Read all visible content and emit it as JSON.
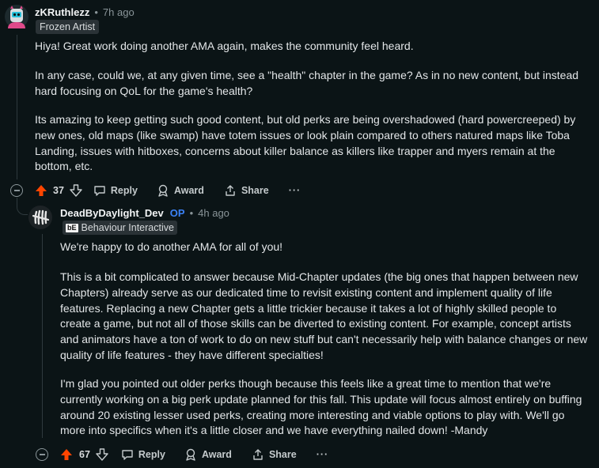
{
  "comment1": {
    "username": "zKRuthlezz",
    "time": "7h ago",
    "flair": "Frozen Artist",
    "paragraphs": [
      "Hiya! Great work doing another AMA again, makes the community feel heard.",
      "In any case, could we, at any given time, see a \"health\" chapter in the game? As in no new content, but instead hard focusing on QoL for the game's health?",
      "Its amazing to keep getting such good content, but old perks are being overshadowed (hard powercreeped) by new ones, old maps (like swamp) have totem issues or look plain compared to others natured maps like Toba Landing, issues with hitboxes, concerns about killer balance as killers like trapper and myers remain at the bottom, etc."
    ],
    "score": "37",
    "reply": "Reply",
    "award": "Award",
    "share": "Share",
    "more": "···"
  },
  "comment2": {
    "username": "DeadByDaylight_Dev",
    "op": "OP",
    "time": "4h ago",
    "flair_logo": "bE",
    "flair": "Behaviour Interactive",
    "paragraphs": [
      "We're happy to do another AMA for all of you!",
      "This is a bit complicated to answer because Mid-Chapter updates (the big ones that happen between new Chapters) already serve as our dedicated time to revisit existing content and implement quality of life features. Replacing a new Chapter gets a little trickier because it takes a lot of highly skilled people to create a game, but not all of those skills can be diverted to existing content. For example, concept artists and animators have a ton of work to do on new stuff but can't necessarily help with balance changes or new quality of life features - they have different specialties!",
      "I'm glad you pointed out older perks  though because this feels like a great time to mention that we're currently working on a big perk update planned for this fall. This update will focus almost entirely on buffing around 20 existing lesser used perks, creating more interesting and viable options to play with. We'll go more into specifics when it's a little closer and we have everything nailed down! -Mandy"
    ],
    "score": "67",
    "reply": "Reply",
    "award": "Award",
    "share": "Share",
    "more": "···"
  },
  "colors": {
    "upvote": "#ff4500",
    "op": "#3b82f6",
    "background": "#0b1416"
  }
}
